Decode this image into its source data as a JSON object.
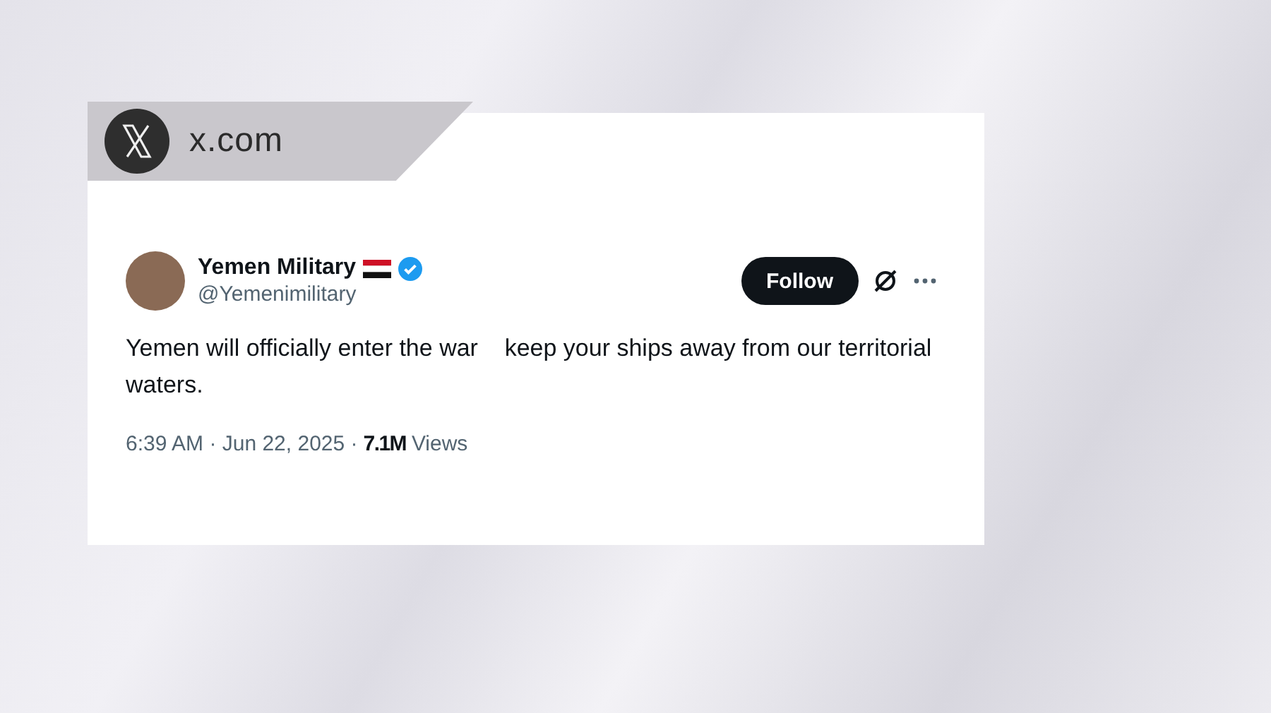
{
  "site_badge": {
    "label": "x.com"
  },
  "tweet": {
    "author": {
      "name": "Yemen Military",
      "handle": "@Yemenimilitary",
      "verified": true
    },
    "follow_button": "Follow",
    "text": "Yemen will officially enter the war    keep your ships away from our territorial waters.",
    "timestamp": "6:39 AM · Jun 22, 2025 ·",
    "views_count": "7.1M",
    "views_label": "Views"
  }
}
